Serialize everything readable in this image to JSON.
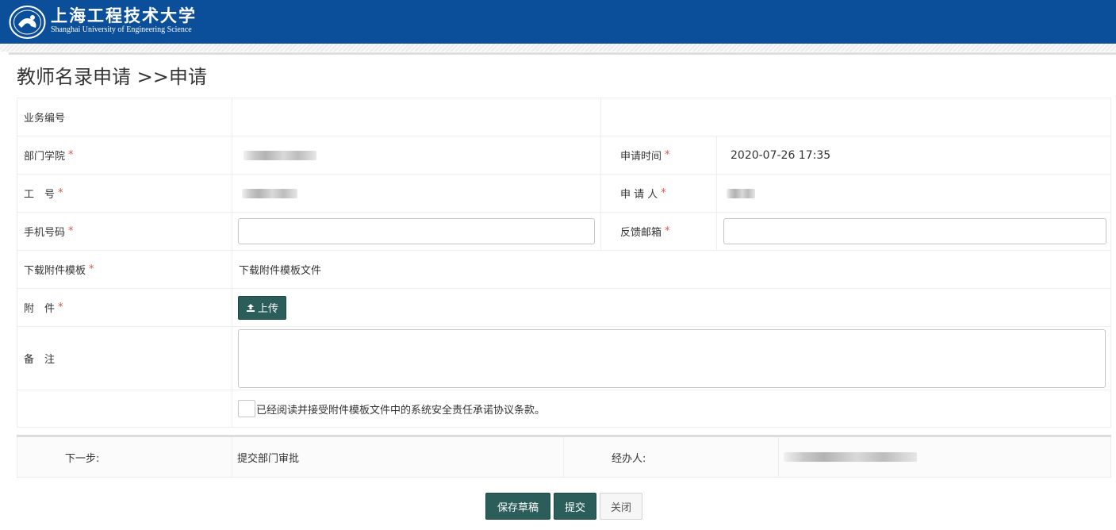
{
  "header": {
    "logo_cn": "上海工程技术大学",
    "logo_en": "Shanghai University of Engineering Science",
    "brand_color": "#0b4f9a"
  },
  "page_title": "教师名录申请 >>申请",
  "form": {
    "business_no_label": "业务编号",
    "dept_label": "部门学院",
    "apply_time_label": "申请时间",
    "apply_time_value": "2020-07-26 17:35",
    "staff_no_label": "工　号",
    "applicant_label": "申 请 人",
    "phone_label": "手机号码",
    "email_label": "反馈邮箱",
    "template_label": "下载附件模板",
    "template_link": "下载附件模板文件",
    "attachment_label": "附　件",
    "upload_label": "上传",
    "remark_label": "备　注",
    "agree_text": "已经阅读并接受附件模板文件中的系统安全责任承诺协议条款。",
    "required_mark": "*"
  },
  "workflow": {
    "next_step_label": "下一步:",
    "next_step_value": "提交部门审批",
    "handler_label": "经办人:"
  },
  "buttons": {
    "save_draft": "保存草稿",
    "submit": "提交",
    "close": "关闭"
  },
  "colors": {
    "primary_button": "#2b5e5a",
    "required": "#d9534f"
  }
}
